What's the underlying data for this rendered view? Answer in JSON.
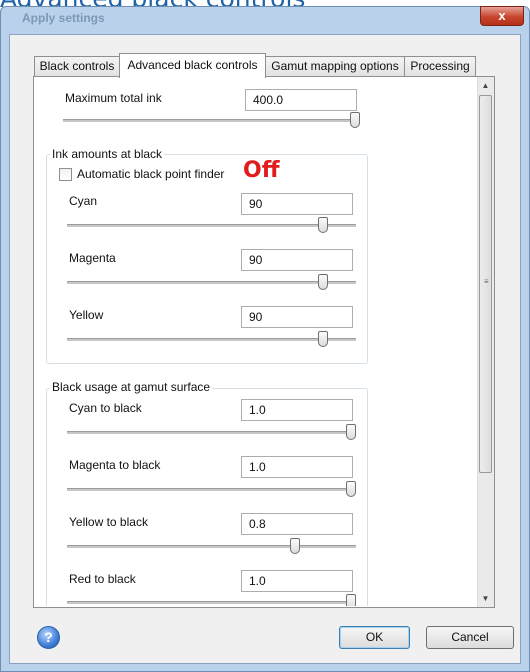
{
  "page_heading": "Advanced black controls",
  "window": {
    "title": "Apply settings",
    "close_label": "x"
  },
  "tabs": [
    {
      "label": "Black controls",
      "active": false
    },
    {
      "label": "Advanced black controls",
      "active": true
    },
    {
      "label": "Gamut mapping options",
      "active": false
    },
    {
      "label": "Processing",
      "active": false
    }
  ],
  "max_ink": {
    "label": "Maximum total ink",
    "value": "400.0",
    "slider_level": 1.0
  },
  "ink_amounts": {
    "title": "Ink amounts at black",
    "auto_black_label": "Automatic black point finder",
    "auto_black_checked": false,
    "annotation": "Off",
    "rows": [
      {
        "label": "Cyan",
        "value": "90",
        "slider_level": 0.9
      },
      {
        "label": "Magenta",
        "value": "90",
        "slider_level": 0.9
      },
      {
        "label": "Yellow",
        "value": "90",
        "slider_level": 0.9
      }
    ]
  },
  "gamut_surface": {
    "title": "Black usage at gamut surface",
    "rows": [
      {
        "label": "Cyan to black",
        "value": "1.0",
        "slider_level": 1.0
      },
      {
        "label": "Magenta to black",
        "value": "1.0",
        "slider_level": 1.0
      },
      {
        "label": "Yellow to black",
        "value": "0.8",
        "slider_level": 0.8
      },
      {
        "label": "Red to black",
        "value": "1.0",
        "slider_level": 1.0
      }
    ]
  },
  "footer": {
    "help_glyph": "?",
    "ok_label": "OK",
    "cancel_label": "Cancel"
  },
  "icons": {
    "help": "help-icon",
    "close": "close-icon",
    "scroll_up": "scroll-up-icon",
    "scroll_down": "scroll-down-icon"
  }
}
